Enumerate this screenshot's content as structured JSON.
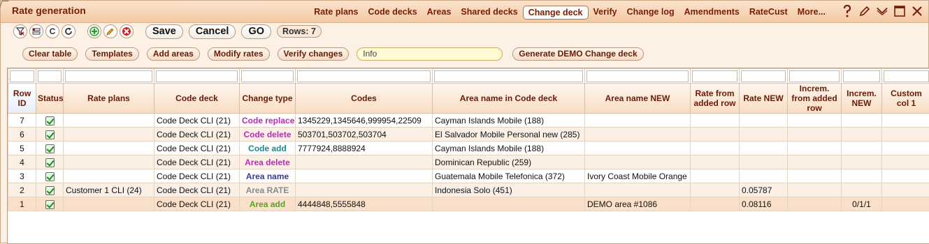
{
  "window": {
    "title": "Rate generation"
  },
  "nav": {
    "items": [
      {
        "label": "Rate plans",
        "active": false
      },
      {
        "label": "Code decks",
        "active": false
      },
      {
        "label": "Areas",
        "active": false
      },
      {
        "label": "Shared decks",
        "active": false
      },
      {
        "label": "Change deck",
        "active": true
      },
      {
        "label": "Verify",
        "active": false
      },
      {
        "label": "Change log",
        "active": false
      },
      {
        "label": "Amendments",
        "active": false
      },
      {
        "label": "RateCust",
        "active": false
      },
      {
        "label": "More...",
        "active": false
      }
    ],
    "icons": [
      "help-icon",
      "edit-pencil-icon",
      "collapse-chevron-icon",
      "maximize-icon",
      "close-icon"
    ]
  },
  "toolbar": {
    "icon_buttons": [
      "filter-clear-icon",
      "columns-icon",
      "refresh-icon",
      "reload-icon"
    ],
    "icon_buttons2": [
      "add-icon",
      "edit-icon",
      "delete-icon"
    ],
    "refresh_label": "C",
    "save_label": "Save",
    "cancel_label": "Cancel",
    "go_label": "GO",
    "rows_label": "Rows: 7"
  },
  "actions": {
    "clear_table": "Clear table",
    "templates": "Templates",
    "add_areas": "Add areas",
    "modify_rates": "Modify rates",
    "verify_changes": "Verify changes",
    "info_placeholder": "Info",
    "generate_demo": "Generate DEMO Change deck"
  },
  "colors": {
    "accent": "#7a1c06",
    "code_replace": "#c026c0",
    "code_delete": "#c026c0",
    "code_add": "#1a8a8a",
    "area_delete": "#c026c0",
    "area_name": "#3a3aa0",
    "area_rate": "#8a8a8a",
    "area_add": "#5aa02a",
    "codes_link": "#1d5ea8"
  },
  "grid": {
    "columns": [
      "Row ID",
      "Status",
      "Rate plans",
      "Code deck",
      "Change type",
      "Codes",
      "Area name in Code deck",
      "Area name NEW",
      "Rate from added row",
      "Rate NEW",
      "Increm. from added row",
      "Increm. NEW",
      "Custom col 1"
    ],
    "rows": [
      {
        "id": "7",
        "rate_plans": "",
        "code_deck": "Code Deck CLI (21)",
        "change_type": "Code replace",
        "type_color": "#c026c0",
        "codes": "1345229,1345646,999954,22509",
        "area_deck": "Cayman Islands Mobile (188)",
        "area_new": "",
        "rate_added": "",
        "rate_new": "",
        "inc_added": "",
        "inc_new": "",
        "custom1": ""
      },
      {
        "id": "6",
        "rate_plans": "",
        "code_deck": "Code Deck CLI (21)",
        "change_type": "Code delete",
        "type_color": "#c026c0",
        "codes": "503701,503702,503704",
        "area_deck": "El Salvador Mobile Personal new (285)",
        "area_new": "",
        "rate_added": "",
        "rate_new": "",
        "inc_added": "",
        "inc_new": "",
        "custom1": ""
      },
      {
        "id": "5",
        "rate_plans": "",
        "code_deck": "Code Deck CLI (21)",
        "change_type": "Code add",
        "type_color": "#1a8a8a",
        "codes": "7777924,8888924",
        "area_deck": "Cayman Islands Mobile (188)",
        "area_new": "",
        "rate_added": "",
        "rate_new": "",
        "inc_added": "",
        "inc_new": "",
        "custom1": ""
      },
      {
        "id": "4",
        "rate_plans": "",
        "code_deck": "Code Deck CLI (21)",
        "change_type": "Area delete",
        "type_color": "#c026c0",
        "codes": "",
        "area_deck": "Dominican Republic (259)",
        "area_new": "",
        "rate_added": "",
        "rate_new": "",
        "inc_added": "",
        "inc_new": "",
        "custom1": ""
      },
      {
        "id": "3",
        "rate_plans": "",
        "code_deck": "Code Deck CLI (21)",
        "change_type": "Area name",
        "type_color": "#3a3aa0",
        "codes": "",
        "area_deck": "Guatemala Mobile Telefonica (372)",
        "area_new": "Ivory Coast Mobile Orange",
        "rate_added": "",
        "rate_new": "",
        "inc_added": "",
        "inc_new": "",
        "custom1": ""
      },
      {
        "id": "2",
        "rate_plans": "Customer 1 CLI (24)",
        "code_deck": "Code Deck CLI (21)",
        "change_type": "Area RATE",
        "type_color": "#8a8a8a",
        "codes": "",
        "area_deck": "Indonesia Solo (451)",
        "area_new": "",
        "rate_added": "",
        "rate_new": "0.05787",
        "inc_added": "",
        "inc_new": "",
        "custom1": ""
      },
      {
        "id": "1",
        "rate_plans": "",
        "code_deck": "Code Deck CLI (21)",
        "change_type": "Area add",
        "type_color": "#5aa02a",
        "codes": "4444848,5555848",
        "area_deck": "",
        "area_new": "DEMO area #1086",
        "rate_added": "",
        "rate_new": "0.08116",
        "inc_added": "",
        "inc_new": "0/1/1",
        "custom1": ""
      }
    ]
  }
}
